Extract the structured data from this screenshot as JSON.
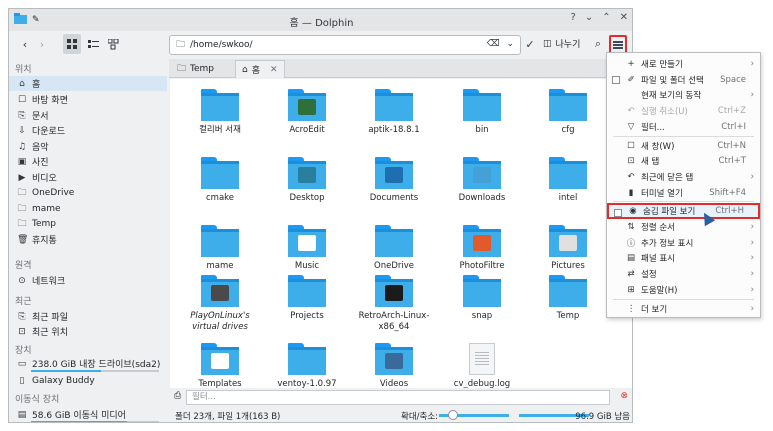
{
  "window": {
    "title": "홈 — Dolphin"
  },
  "toolbar": {
    "address": "/home/swkoo/",
    "split_label": "나누기"
  },
  "sidebar": {
    "sections": {
      "places": "위치",
      "remote": "원격",
      "recent": "최근",
      "devices": "장치",
      "removable": "이동식 장치"
    },
    "places": [
      {
        "label": "홈",
        "icon": "home-icon"
      },
      {
        "label": "바탕 화면",
        "icon": "desktop-icon"
      },
      {
        "label": "문서",
        "icon": "documents-icon"
      },
      {
        "label": "다운로드",
        "icon": "download-icon"
      },
      {
        "label": "음악",
        "icon": "music-icon"
      },
      {
        "label": "사진",
        "icon": "pictures-icon"
      },
      {
        "label": "비디오",
        "icon": "video-icon"
      },
      {
        "label": "OneDrive",
        "icon": "folder-icon"
      },
      {
        "label": "mame",
        "icon": "folder-icon"
      },
      {
        "label": "Temp",
        "icon": "folder-icon"
      },
      {
        "label": "휴지통",
        "icon": "trash-icon"
      }
    ],
    "remote": [
      {
        "label": "네트워크",
        "icon": "network-icon"
      }
    ],
    "recent": [
      {
        "label": "최근 파일",
        "icon": "recent-files-icon"
      },
      {
        "label": "최근 위치",
        "icon": "recent-locations-icon"
      }
    ],
    "devices": [
      {
        "label": "238.0 GiB 내장 드라이브(sda2)",
        "icon": "drive-icon",
        "usage": 0.55
      },
      {
        "label": "Galaxy Buddy",
        "icon": "phone-icon"
      }
    ],
    "removable": [
      {
        "label": "58.6 GiB 이동식 미디어",
        "icon": "usb-icon",
        "usage": 0.75
      }
    ]
  },
  "tabs": [
    {
      "label": "Temp"
    },
    {
      "label": "홈"
    }
  ],
  "files": [
    {
      "name": "컬리버 서재",
      "kind": "folder"
    },
    {
      "name": "AcroEdit",
      "kind": "folder-app"
    },
    {
      "name": "aptik-18.8.1",
      "kind": "folder"
    },
    {
      "name": "bin",
      "kind": "folder"
    },
    {
      "name": "cfg",
      "kind": "folder"
    },
    {
      "name": "cmake",
      "kind": "folder"
    },
    {
      "name": "Desktop",
      "kind": "folder-desktop"
    },
    {
      "name": "Documents",
      "kind": "folder-docs"
    },
    {
      "name": "Downloads",
      "kind": "folder-downloads"
    },
    {
      "name": "intel",
      "kind": "folder"
    },
    {
      "name": "mame",
      "kind": "folder"
    },
    {
      "name": "Music",
      "kind": "folder-music"
    },
    {
      "name": "OneDrive",
      "kind": "folder"
    },
    {
      "name": "PhotoFiltre",
      "kind": "folder-photo"
    },
    {
      "name": "Pictures",
      "kind": "folder-pictures"
    },
    {
      "name": "PlayOnLinux's virtual drives",
      "kind": "folder-pol",
      "italic": true
    },
    {
      "name": "Projects",
      "kind": "folder"
    },
    {
      "name": "RetroArch-Linux-x86_64",
      "kind": "folder-retro"
    },
    {
      "name": "snap",
      "kind": "folder"
    },
    {
      "name": "Temp",
      "kind": "folder"
    },
    {
      "name": "Templates",
      "kind": "folder-templates"
    },
    {
      "name": "ventoy-1.0.97",
      "kind": "folder"
    },
    {
      "name": "Videos",
      "kind": "folder-videos"
    },
    {
      "name": "cv_debug.log",
      "kind": "file"
    }
  ],
  "filter": {
    "placeholder": "필터..."
  },
  "status": {
    "summary": "폴더 23개, 파일 1개(163 B)",
    "zoom_label": "확대/축소:",
    "zoom_level": 0.15,
    "free": "96.9 GiB 남음"
  },
  "menu": {
    "items": [
      {
        "icon": "+",
        "label": "새로 만들기",
        "arrow": true
      },
      {
        "checkbox": true,
        "icon": "✐",
        "label": "파일 및 폴더 선택",
        "shortcut": "Space"
      },
      {
        "label": "현재 보기의 동작",
        "arrow": true
      },
      {
        "icon": "↶",
        "label": "실행 취소(U)",
        "shortcut": "Ctrl+Z",
        "disabled": true
      },
      {
        "icon": "▽",
        "label": "필터...",
        "shortcut": "Ctrl+I"
      },
      {
        "sep": true
      },
      {
        "icon": "☐",
        "label": "새 창(W)",
        "shortcut": "Ctrl+N"
      },
      {
        "icon": "⊡",
        "label": "새 탭",
        "shortcut": "Ctrl+T"
      },
      {
        "icon": "↶",
        "label": "최근에 닫은 탭",
        "arrow": true
      },
      {
        "icon": "▮",
        "label": "터미널 열기",
        "shortcut": "Shift+F4"
      },
      {
        "sep": true
      },
      {
        "checkbox": true,
        "icon": "◉",
        "label": "숨김 파일 보기",
        "shortcut": "Ctrl+H",
        "highlight": true
      },
      {
        "icon": "⇅",
        "label": "정렬 순서",
        "arrow": true
      },
      {
        "icon": "ⓘ",
        "label": "추가 정보 표시",
        "arrow": true
      },
      {
        "icon": "▤",
        "label": "패널 표시",
        "arrow": true
      },
      {
        "icon": "⇄",
        "label": "설정",
        "arrow": true
      },
      {
        "icon": "⊞",
        "label": "도움말(H)",
        "arrow": true
      },
      {
        "sep": true
      },
      {
        "icon": "⋮",
        "label": "더 보기",
        "arrow": true
      }
    ]
  },
  "colors": {
    "accent": "#3daee9",
    "highlight_border": "#e32b2b"
  }
}
